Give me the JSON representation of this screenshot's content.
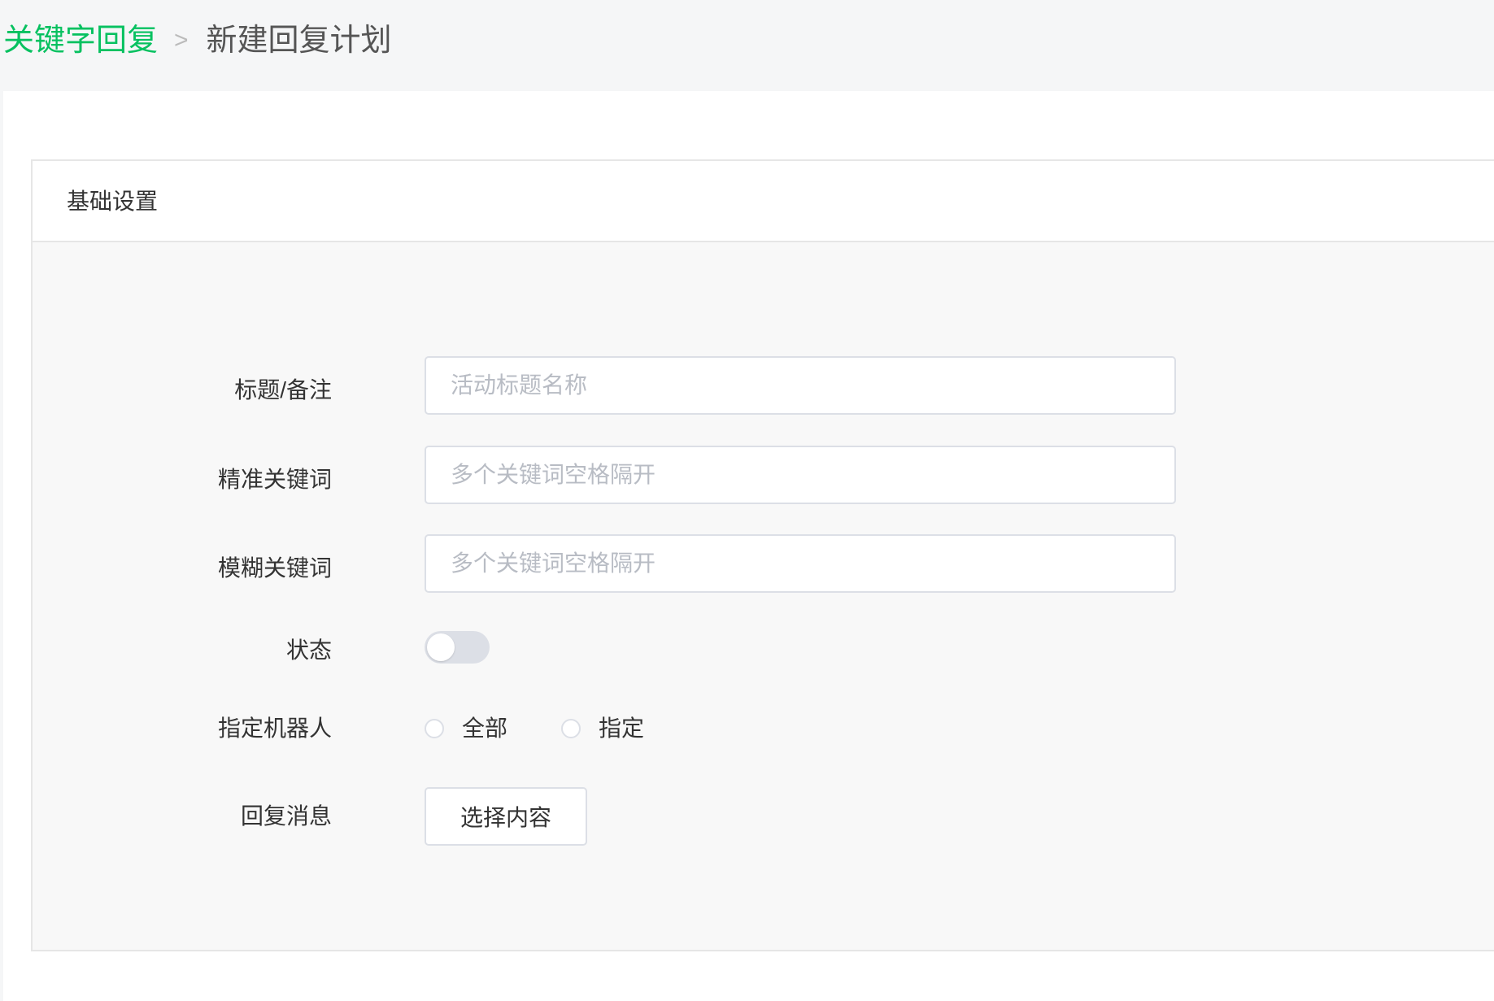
{
  "breadcrumb": {
    "parent": "关键字回复",
    "separator": ">",
    "current": "新建回复计划"
  },
  "panel": {
    "title": "基础设置"
  },
  "form": {
    "title_field": {
      "label": "标题/备注",
      "placeholder": "活动标题名称",
      "value": ""
    },
    "exact_keywords": {
      "label": "精准关键词",
      "placeholder": "多个关键词空格隔开",
      "value": ""
    },
    "fuzzy_keywords": {
      "label": "模糊关键词",
      "placeholder": "多个关键词空格隔开",
      "value": ""
    },
    "status": {
      "label": "状态",
      "enabled": false
    },
    "robot": {
      "label": "指定机器人",
      "options": [
        "全部",
        "指定"
      ],
      "selected": null
    },
    "reply": {
      "label": "回复消息",
      "button": "选择内容"
    }
  },
  "colors": {
    "accent": "#07c160",
    "page_background": "#f5f6f7",
    "panel_background": "#f8f8f8",
    "border": "#dcdfe6",
    "placeholder": "#b8bcc4"
  },
  "icons": {
    "breadcrumb_separator": "chevron-right-icon"
  }
}
